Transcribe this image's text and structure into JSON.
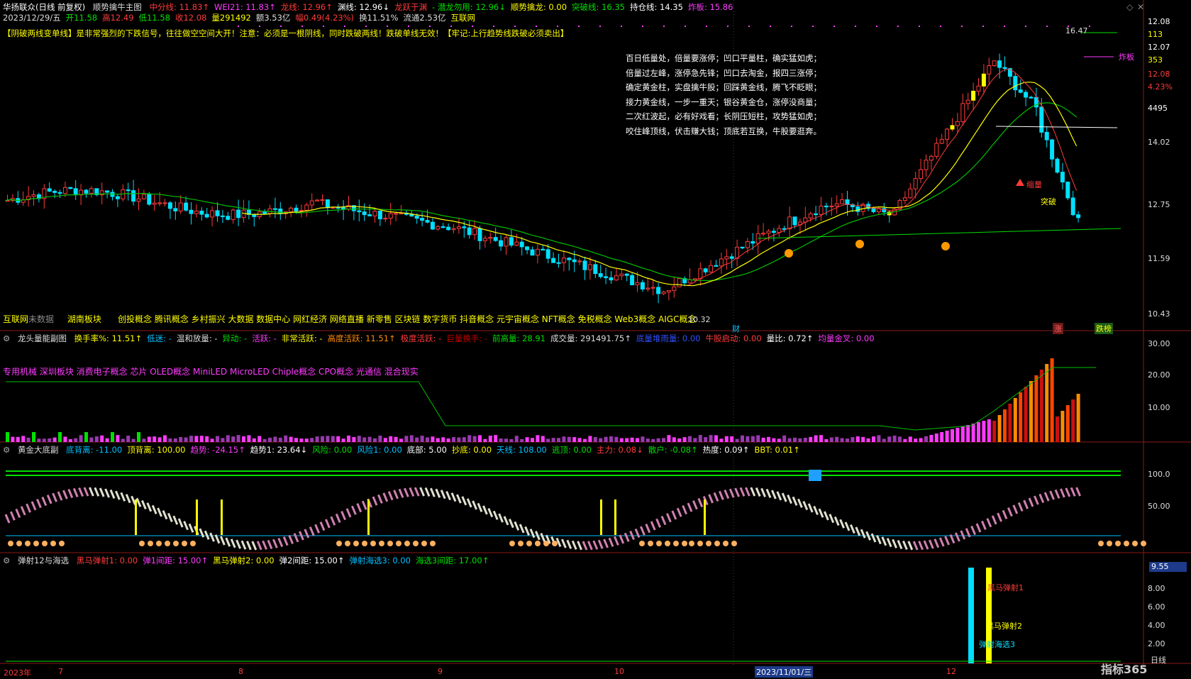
{
  "header": {
    "stock_title": "华扬联众(日线 前复权)",
    "main_indicator_name": "顺势擒牛主图",
    "items": [
      {
        "text": "中分线: 11.83↑",
        "color": "#ff3b3b"
      },
      {
        "text": "WEI21: 11.83↑",
        "color": "#ff3bff"
      },
      {
        "text": "龙线: 12.96↑",
        "color": "#ff3b3b"
      },
      {
        "text": "渊线: 12.96↓",
        "color": "#ffffff"
      },
      {
        "text": "龙跃于渊",
        "color": "#ff3b3b"
      },
      {
        "text": "- 潜龙勿用: 12.96↓",
        "color": "#00e000"
      },
      {
        "text": "顺势擒龙: 0.00",
        "color": "#ffff00"
      },
      {
        "text": "突破线: 16.35",
        "color": "#00e000"
      },
      {
        "text": "持仓线: 14.35",
        "color": "#ffffff"
      },
      {
        "text": "炸板: 15.86",
        "color": "#ff3bff"
      }
    ],
    "ohlc_line": [
      {
        "text": "2023/12/29/五",
        "color": "#dddddd"
      },
      {
        "text": "开11.58",
        "color": "#00e000"
      },
      {
        "text": "高12.49",
        "color": "#ff3b3b"
      },
      {
        "text": "低11.58",
        "color": "#00e000"
      },
      {
        "text": "收12.08",
        "color": "#ff3b3b"
      },
      {
        "text": "量291492",
        "color": "#ffff00"
      },
      {
        "text": "额3.53亿",
        "color": "#dddddd"
      },
      {
        "text": "幅0.49(4.23%)",
        "color": "#ff3b3b"
      },
      {
        "text": "换11.51%",
        "color": "#dddddd"
      },
      {
        "text": "流通2.53亿",
        "color": "#dddddd"
      },
      {
        "text": "互联网",
        "color": "#ffff00"
      }
    ]
  },
  "notice": "【阴破两线变单线】是非常强烈的下跌信号，往往做空空间大开！注意：必须是一根阴线，同时跌破两线！跌破单线无效！【牢记:上行趋势线跌破必须卖出】",
  "poem": [
    "百日低量处，倍量要涨停；凹口平量柱，确实猛如虎；",
    "倍量过左峰，涨停急先锋；凹口去淘金，报四三涨停；",
    "确定黄金柱，实盘擒牛股；回踩黄金线，腾飞不眨眼；",
    "接力黄金线，一步一重天；银谷黄金仓，涨停没商量；",
    "二次红波起，必有好戏看；长阴压短柱，攻势猛如虎；",
    "咬住峰顶线，伏击赚大钱；顶底若互换，牛股要逛奔。"
  ],
  "chart_labels": {
    "high": "16.47",
    "low": "10.32",
    "zhaban": "炸板",
    "suojian": "缩量",
    "tupo": "突破",
    "cai": "财",
    "zhang": "涨",
    "diebang": "跌榜"
  },
  "sectors": {
    "industry": "互联网",
    "industry_note": "未数据",
    "region": "湖南板块",
    "concepts": "创投概念 腾讯概念 乡村振兴 大数据 数据中心 网红经济 网络直播 新零售 区块链 数字货币 抖音概念 元宇宙概念 NFT概念 免税概念 Web3概念 AIGC概念"
  },
  "main_axis": {
    "ticks": [
      "12.08",
      "113",
      "12.07",
      "353",
      "12.08",
      "4.23%",
      "4495",
      "14.02",
      "12.75",
      "11.59",
      "10.43"
    ],
    "tick_colors": [
      "#ffffff",
      "#ffff00",
      "#ffffff",
      "#ffff00",
      "#ff3b3b",
      "#ff3b3b",
      "#ffffff",
      "#dddddd",
      "#dddddd",
      "#dddddd",
      "#dddddd"
    ]
  },
  "panel2": {
    "name": "龙头量能副图",
    "items": [
      {
        "text": "换手率%: 11.51↑",
        "color": "#ffff00"
      },
      {
        "text": "低迷: -",
        "color": "#00c0ff"
      },
      {
        "text": "温和放量: -",
        "color": "#dddddd"
      },
      {
        "text": "异动: -",
        "color": "#00e000"
      },
      {
        "text": "活跃: -",
        "color": "#ff3bff"
      },
      {
        "text": "非常活跃: -",
        "color": "#ffff00"
      },
      {
        "text": "高度活跃: 11.51↑",
        "color": "#ff8c00"
      },
      {
        "text": "极度活跃: -",
        "color": "#ff3b3b"
      },
      {
        "text": "巨量换手: -",
        "color": "#c00000"
      },
      {
        "text": "前高量: 28.91",
        "color": "#00e000"
      },
      {
        "text": "成交量: 291491.75↑",
        "color": "#dddddd"
      },
      {
        "text": "底量堆雨量: 0.00",
        "color": "#3050ff"
      },
      {
        "text": "牛股启动: 0.00",
        "color": "#ff3b3b"
      },
      {
        "text": "量比: 0.72↑",
        "color": "#ffffff"
      },
      {
        "text": "均量金叉: 0.00",
        "color": "#ff3bff"
      }
    ],
    "concepts": "专用机械 深圳板块 消费电子概念 芯片 OLED概念 MiniLED MicroLED Chiple概念 CPO概念 光通信 混合现实",
    "ticks": [
      "30.00",
      "20.00",
      "10.00"
    ]
  },
  "panel3": {
    "name": "黄金大底副",
    "items": [
      {
        "text": "底背离: -11.00",
        "color": "#00c0ff"
      },
      {
        "text": "顶背离: 100.00",
        "color": "#ffff00"
      },
      {
        "text": "趋势: -24.15↑",
        "color": "#ff3bff"
      },
      {
        "text": "趋势1: 23.64↓",
        "color": "#ffffff"
      },
      {
        "text": "风险: 0.00",
        "color": "#00e000"
      },
      {
        "text": "风险1: 0.00",
        "color": "#00c0ff"
      },
      {
        "text": "底部: 5.00",
        "color": "#ffffff"
      },
      {
        "text": "抄底: 0.00",
        "color": "#ffff00"
      },
      {
        "text": "天线: 108.00",
        "color": "#00c0ff"
      },
      {
        "text": "逃顶: 0.00",
        "color": "#00e000"
      },
      {
        "text": "主力: 0.08↓",
        "color": "#ff3b3b"
      },
      {
        "text": "散户: -0.08↑",
        "color": "#00e000"
      },
      {
        "text": "热度: 0.09↑",
        "color": "#ffffff"
      },
      {
        "text": "BBT: 0.01↑",
        "color": "#ffff00"
      }
    ],
    "ticks": [
      "100.0",
      "50.00"
    ]
  },
  "panel4": {
    "name": "弹射12与海选",
    "items": [
      {
        "text": "黑马弹射1: 0.00",
        "color": "#ff3b3b"
      },
      {
        "text": "弹1间距: 15.00↑",
        "color": "#ff3bff"
      },
      {
        "text": "黑马弹射2: 0.00",
        "color": "#ffff00"
      },
      {
        "text": "弹2间距: 15.00↑",
        "color": "#ffffff"
      },
      {
        "text": "弹射海选3: 0.00",
        "color": "#00c0ff"
      },
      {
        "text": "海选3间距: 17.00↑",
        "color": "#00e000"
      }
    ],
    "labels": [
      "黑马弹射1",
      "黑马弹射2",
      "弹射海选3"
    ],
    "current": "9.55",
    "ticks": [
      "8.00",
      "6.00",
      "4.00",
      "2.00"
    ]
  },
  "bottom_axis": {
    "labels": [
      "2023年",
      "7",
      "8",
      "9",
      "10",
      "2023/11/01/三",
      "12"
    ],
    "period": "日线",
    "watermark": "指标365"
  }
}
